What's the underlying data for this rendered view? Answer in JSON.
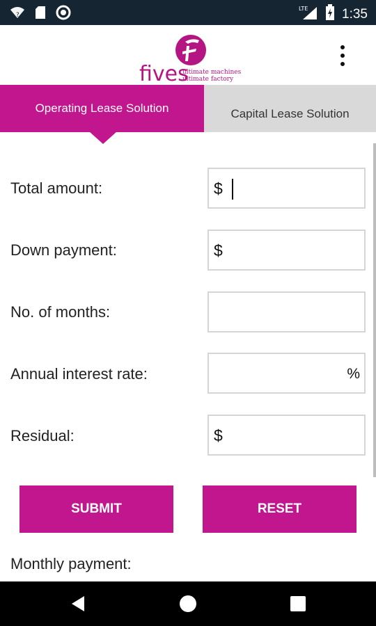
{
  "status_bar": {
    "time": "1:35",
    "network": "LTE",
    "icons": [
      "wifi-icon",
      "sd-card-icon",
      "sync-icon",
      "signal-icon",
      "battery-icon"
    ]
  },
  "app_bar": {
    "logo_text": "fives",
    "logo_tagline_1": "ultimate machines",
    "logo_tagline_2": "ultimate factory",
    "menu_icon": "more-vert-icon"
  },
  "tabs": [
    {
      "label": "Operating Lease Solution",
      "active": true
    },
    {
      "label": "Capital Lease Solution",
      "active": false
    }
  ],
  "form": {
    "total_amount": {
      "label": "Total amount:",
      "prefix": "$",
      "value": ""
    },
    "down_payment": {
      "label": "Down payment:",
      "prefix": "$",
      "value": ""
    },
    "months": {
      "label": "No. of months:",
      "value": ""
    },
    "interest": {
      "label": "Annual interest rate:",
      "suffix": "%",
      "value": ""
    },
    "residual": {
      "label": "Residual:",
      "prefix": "$",
      "value": ""
    }
  },
  "buttons": {
    "submit": "SUBMIT",
    "reset": "RESET"
  },
  "result": {
    "label": "Monthly payment:"
  },
  "colors": {
    "accent": "#c2168e",
    "status_bar": "#162532",
    "inactive_tab": "#d9d9d9"
  }
}
